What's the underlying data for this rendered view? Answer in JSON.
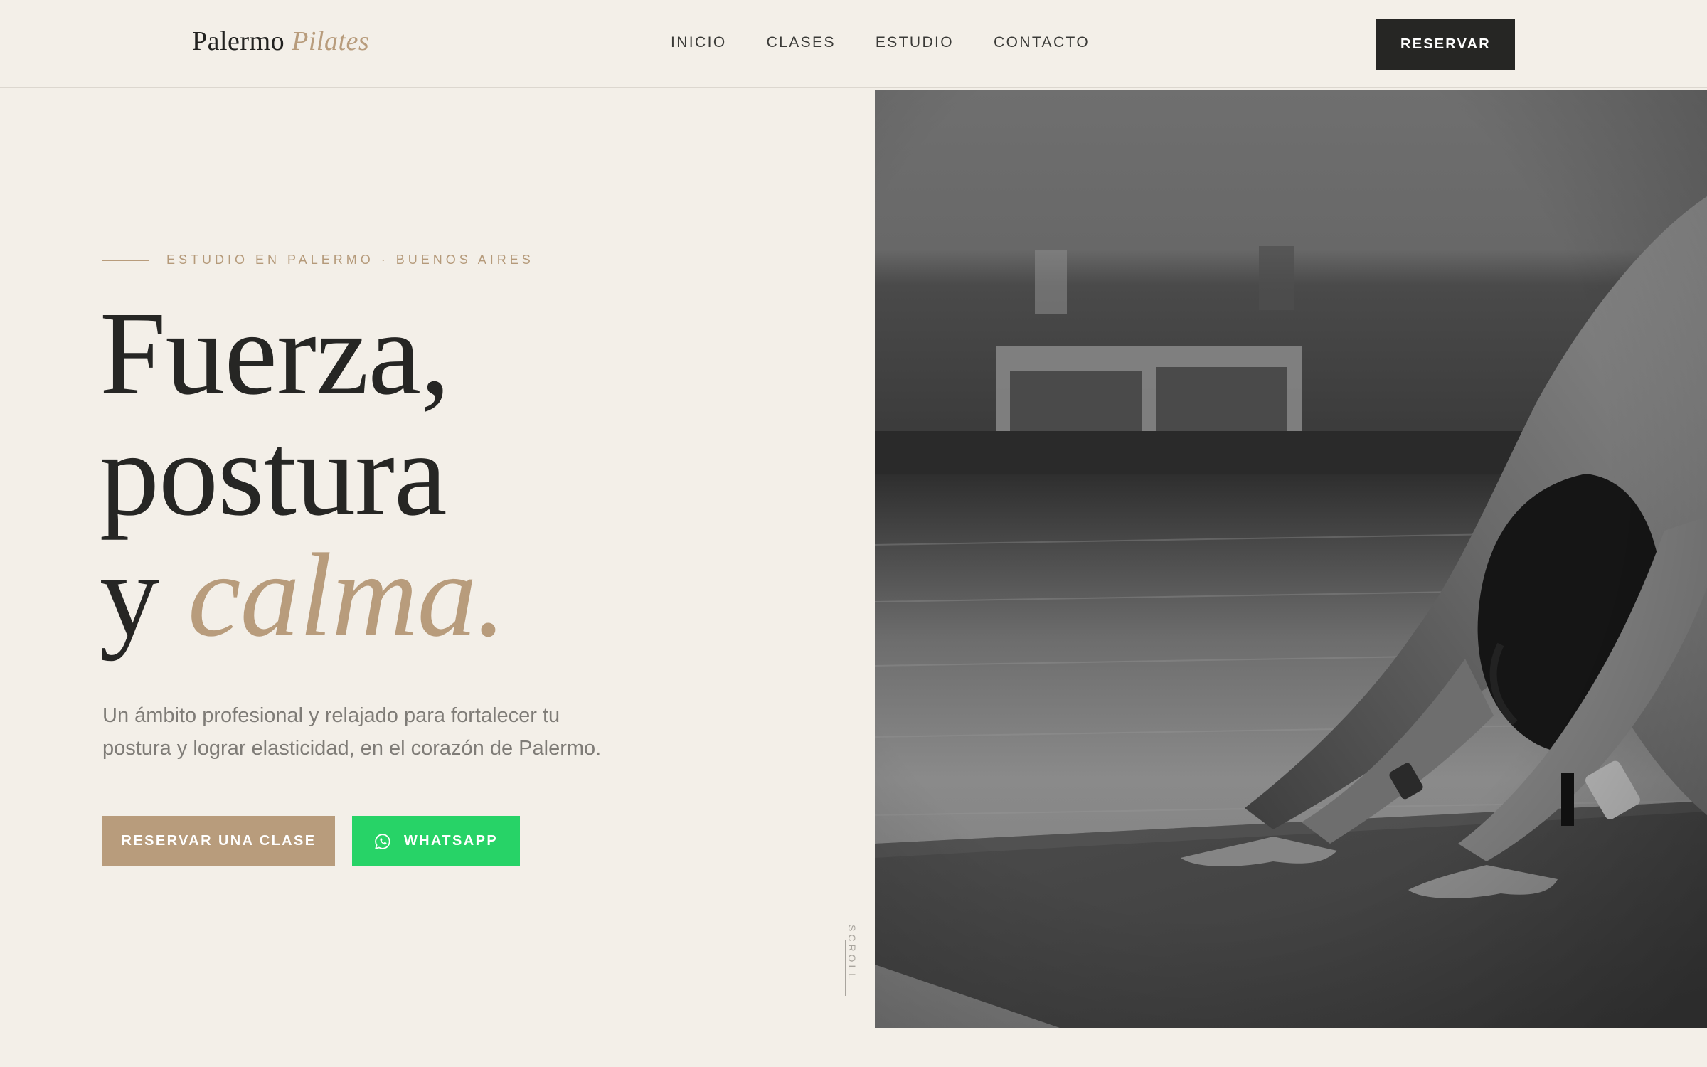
{
  "brand": {
    "name": "Palermo",
    "accent": "Pilates"
  },
  "nav": {
    "items": [
      {
        "label": "INICIO"
      },
      {
        "label": "CLASES"
      },
      {
        "label": "ESTUDIO"
      },
      {
        "label": "CONTACTO"
      }
    ],
    "cta_label": "RESERVAR"
  },
  "hero": {
    "eyebrow": "ESTUDIO EN PALERMO · BUENOS AIRES",
    "headline_line1": "Fuerza,",
    "headline_line2": "postura",
    "headline_line3_prefix": "y",
    "headline_line3_accent": "calma.",
    "subtitle": "Un ámbito profesional y relajado para fortalecer tu postura y lograr elasticidad, en el corazón de Palermo.",
    "primary_cta": "RESERVAR UNA CLASE",
    "whatsapp_cta": "WHATSAPP",
    "scroll_label": "SCROLL",
    "photo_icon": "yoga-pose-photo"
  },
  "colors": {
    "background": "#f3efe8",
    "accent_gold": "#b89c7c",
    "dark": "#262624",
    "whatsapp_green": "#27d367",
    "body_text": "#7f7c77"
  }
}
